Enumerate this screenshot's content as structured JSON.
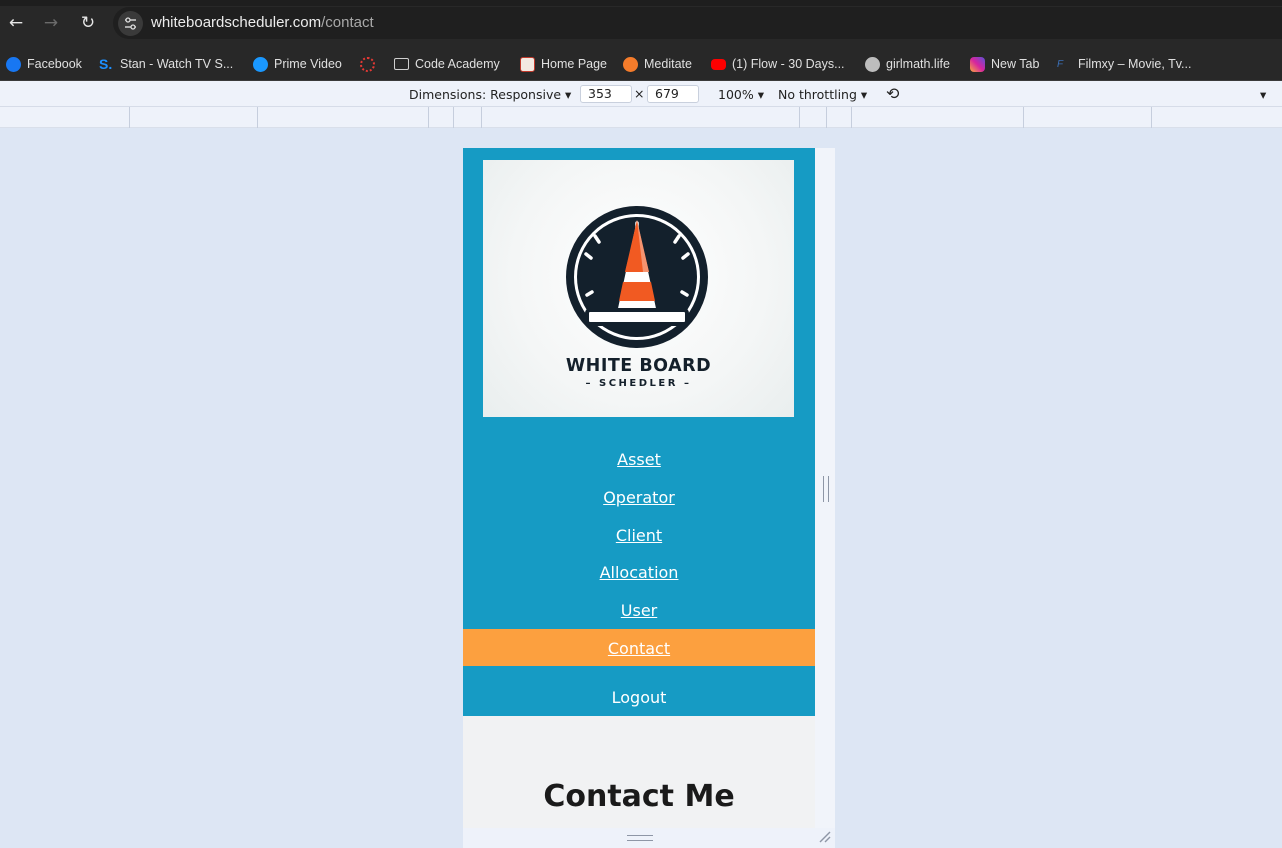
{
  "browser": {
    "url_host": "whiteboardscheduler.com",
    "url_path": "/contact",
    "bookmarks": [
      {
        "label": "Facebook",
        "icon": "facebook-icon",
        "color": "#1877f2"
      },
      {
        "label": "Stan - Watch TV S...",
        "icon": "stan-icon",
        "color": "#1e90ff"
      },
      {
        "label": "Prime Video",
        "icon": "prime-video-icon",
        "color": "#1a98ff"
      },
      {
        "label": "",
        "icon": "loading-circle-icon",
        "color": "#e53935"
      },
      {
        "label": "Code Academy",
        "icon": "folder-icon",
        "color": "#cfcfcf"
      },
      {
        "label": "Home Page",
        "icon": "home-page-favicon",
        "color": "#c0392b"
      },
      {
        "label": "Meditate",
        "icon": "meditate-icon",
        "color": "#f57c2b"
      },
      {
        "label": "(1) Flow - 30 Days...",
        "icon": "youtube-icon",
        "color": "#ff0000"
      },
      {
        "label": "girlmath.life",
        "icon": "globe-icon",
        "color": "#bdbdbd"
      },
      {
        "label": "New Tab",
        "icon": "instagram-icon",
        "color": "#d6249f"
      },
      {
        "label": "Filmxy – Movie, Tv...",
        "icon": "filmxy-icon",
        "color": "#3b6fb6"
      }
    ]
  },
  "devtools": {
    "dimensions_label": "Dimensions: Responsive",
    "width": "353",
    "times": "×",
    "height": "679",
    "zoom": "100%",
    "throttling": "No throttling"
  },
  "page": {
    "logo_title": "WHITE BOARD",
    "logo_subtitle": "– SCHEDLER –",
    "nav": [
      {
        "label": "Asset"
      },
      {
        "label": "Operator"
      },
      {
        "label": "Client"
      },
      {
        "label": "Allocation"
      },
      {
        "label": "User"
      },
      {
        "label": "Contact"
      }
    ],
    "logout": "Logout",
    "heading": "Contact Me",
    "colors": {
      "sidebar": "#169bc4",
      "active": "#fca03f",
      "background": "#f1f2f3"
    }
  }
}
